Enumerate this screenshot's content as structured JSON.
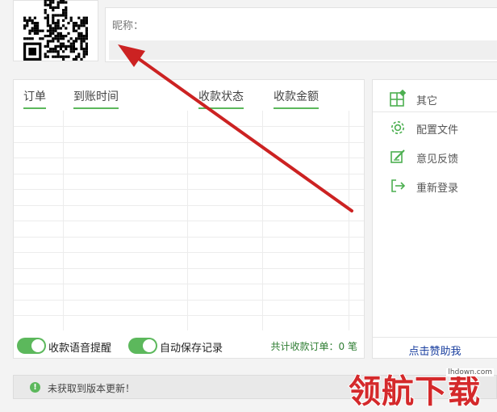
{
  "profile": {
    "nickname_label": "昵称：",
    "nickname_value": ""
  },
  "orders": {
    "columns": [
      "订单",
      "到账时间",
      "收款状态",
      "收款金额"
    ],
    "rows": []
  },
  "options": {
    "voice_reminder_label": "收款语音提醒",
    "voice_reminder_on": true,
    "auto_save_label": "自动保存记录",
    "auto_save_on": true,
    "total_orders_text": "共计收款订单：0 笔"
  },
  "sidebar": {
    "items": [
      {
        "label": "其它",
        "icon": "grid-icon"
      },
      {
        "label": "配置文件",
        "icon": "gear-icon"
      },
      {
        "label": "意见反馈",
        "icon": "edit-icon"
      },
      {
        "label": "重新登录",
        "icon": "logout-icon"
      }
    ],
    "support_label": "点击赞助我"
  },
  "status": {
    "icon": "!",
    "message": "未获取到版本更新！"
  },
  "watermark": {
    "text": "领航下载",
    "url": "lhdown.com"
  },
  "colors": {
    "accent_green": "#5cb85c",
    "arrow_red": "#cc2222",
    "link_blue": "#1a3f9f"
  }
}
